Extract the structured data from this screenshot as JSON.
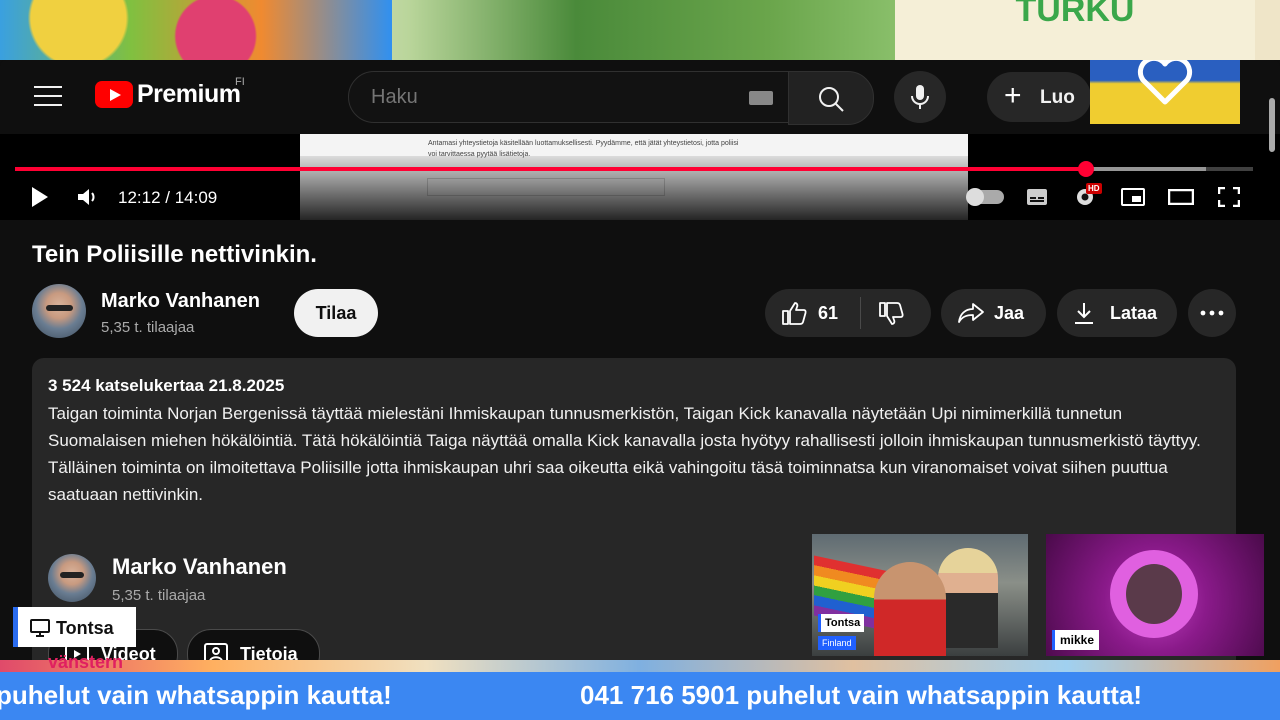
{
  "header": {
    "logo_text": "Premium",
    "region": "FI",
    "search_placeholder": "Haku",
    "create_label": "Luo"
  },
  "player": {
    "time": "12:12 / 14:09",
    "progress": 0.865,
    "buffered": 0.962,
    "hd_badge": "HD",
    "doc_text": "Antamasi yhteystietoja käsitellään luottamuksellisesti. Pyydämme, että jätät yhteystietosi, jotta poliisi voi tarvittaessa pyytää lisätietoja."
  },
  "video": {
    "title": "Tein Poliisille nettivinkin.",
    "channel_name": "Marko Vanhanen",
    "subscribers": "5,35 t. tilaajaa",
    "subscribe_label": "Tilaa",
    "likes": "61",
    "share_label": "Jaa",
    "download_label": "Lataa"
  },
  "description": {
    "meta": "3 524 katselukertaa  21.8.2025",
    "body": "Taigan toiminta Norjan Bergenissä täyttää mielestäni Ihmiskaupan tunnusmerkistön, Taigan Kick kanavalla näytetään Upi nimimerkillä tunnetun Suomalaisen miehen hökälöintiä. Tätä hökälöintiä Taiga näyttää omalla Kick kanavalla josta hyötyy rahallisesti jolloin ihmiskaupan tunnusmerkistö täyttyy. Tälläinen toiminta on ilmoitettava Poliisille jotta ihmiskaupan uhri saa oikeutta eikä vahingoitu täsä toiminnatsa kun viranomaiset voivat siihen puuttua saatuaan nettivinkin.",
    "channel_name": "Marko Vanhanen",
    "subscribers": "5,35 t. tilaajaa",
    "videos_tab": "Videot",
    "about_tab": "Tietoja"
  },
  "overlays": {
    "cam1_name": "Tontsa",
    "cam1_location": "Finland",
    "cam2_name": "mikke",
    "badge_name": "Tontsa",
    "sign_text": "TURKU",
    "banner_text": "vänstern",
    "ticker_left": "puhelut vain whatsappin kautta!",
    "ticker_right": "041 716 5901 puhelut vain whatsappin kautta!"
  },
  "colors": {
    "accent_red": "#ff0033",
    "ticker_blue": "#3b87f2",
    "youtube_dark": "#0f0f0f"
  }
}
